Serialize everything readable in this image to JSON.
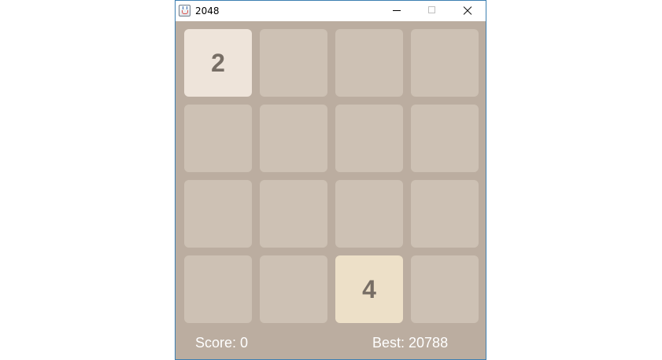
{
  "window": {
    "title": "2048",
    "icon": "java-cup-icon"
  },
  "board": {
    "size": 4,
    "tiles": [
      [
        "2",
        "",
        "",
        ""
      ],
      [
        "",
        "",
        "",
        ""
      ],
      [
        "",
        "",
        "",
        ""
      ],
      [
        "",
        "",
        "4",
        ""
      ]
    ]
  },
  "colors": {
    "board_bg": "#bbada0",
    "empty_tile": "#cdc1b4",
    "tile_2": "#eee4da",
    "tile_4": "#ede0c8",
    "tile_text": "#776e65",
    "footer_text": "#ffffff"
  },
  "footer": {
    "score_text": "Score: 0",
    "best_text": "Best: 20788"
  }
}
